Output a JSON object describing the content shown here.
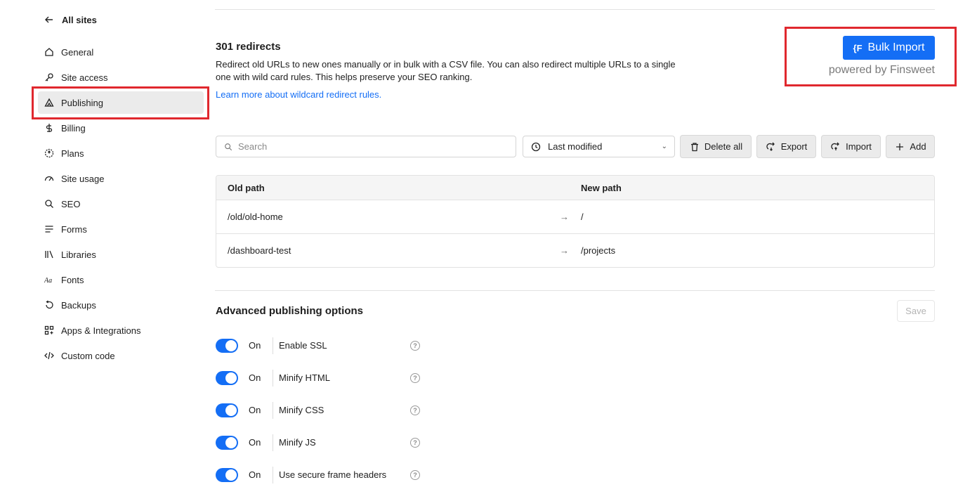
{
  "sidebar": {
    "back_label": "All sites",
    "items": [
      {
        "label": "General",
        "icon": "home-icon"
      },
      {
        "label": "Site access",
        "icon": "key-icon"
      },
      {
        "label": "Publishing",
        "icon": "publish-icon",
        "active": true
      },
      {
        "label": "Billing",
        "icon": "dollar-icon"
      },
      {
        "label": "Plans",
        "icon": "plans-icon"
      },
      {
        "label": "Site usage",
        "icon": "gauge-icon"
      },
      {
        "label": "SEO",
        "icon": "search-icon"
      },
      {
        "label": "Forms",
        "icon": "forms-icon"
      },
      {
        "label": "Libraries",
        "icon": "libraries-icon"
      },
      {
        "label": "Fonts",
        "icon": "fonts-icon"
      },
      {
        "label": "Backups",
        "icon": "backup-icon"
      },
      {
        "label": "Apps & Integrations",
        "icon": "apps-icon"
      },
      {
        "label": "Custom code",
        "icon": "code-icon"
      }
    ]
  },
  "redirects": {
    "title": "301 redirects",
    "description": "Redirect old URLs to new ones manually or in bulk with a CSV file. You can also redirect multiple URLs to a single one with wild card rules. This helps preserve your SEO ranking.",
    "learn_more": "Learn more about wildcard redirect rules.",
    "bulk_import_label": "Bulk Import",
    "bulk_import_logo": "{F",
    "powered_by": "powered by Finsweet",
    "search_placeholder": "Search",
    "sort_value": "Last modified",
    "buttons": {
      "delete_all": "Delete all",
      "export": "Export",
      "import": "Import",
      "add": "Add"
    },
    "table": {
      "headers": [
        "Old path",
        "New path"
      ],
      "rows": [
        {
          "old": "/old/old-home",
          "arrow": "→",
          "new": "/"
        },
        {
          "old": "/dashboard-test",
          "arrow": "→",
          "new": "/projects"
        }
      ]
    }
  },
  "advanced": {
    "title": "Advanced publishing options",
    "save_label": "Save",
    "options": [
      {
        "state": "On",
        "label": "Enable SSL"
      },
      {
        "state": "On",
        "label": "Minify HTML"
      },
      {
        "state": "On",
        "label": "Minify CSS"
      },
      {
        "state": "On",
        "label": "Minify JS"
      },
      {
        "state": "On",
        "label": "Use secure frame headers"
      }
    ]
  },
  "colors": {
    "accent": "#146ef5",
    "highlight": "#e0282e"
  }
}
